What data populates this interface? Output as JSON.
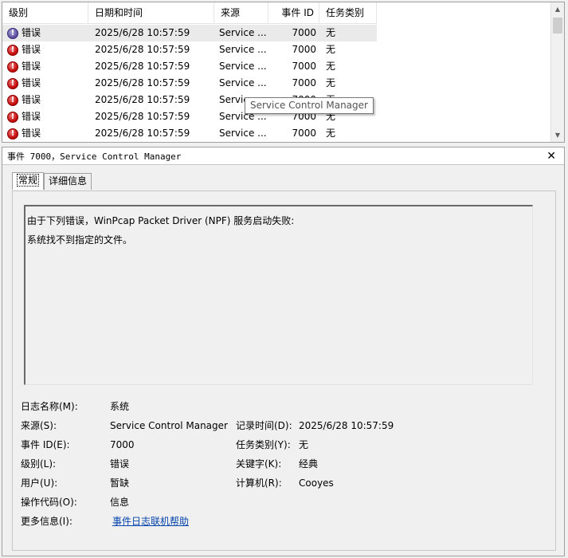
{
  "list": {
    "columns": [
      "级别",
      "日期和时间",
      "来源",
      "事件 ID",
      "任务类别"
    ],
    "rows": [
      {
        "level": "错误",
        "datetime": "2025/6/28 10:57:59",
        "source": "Service ...",
        "event_id": "7000",
        "task": "无"
      },
      {
        "level": "错误",
        "datetime": "2025/6/28 10:57:59",
        "source": "Service ...",
        "event_id": "7000",
        "task": "无"
      },
      {
        "level": "错误",
        "datetime": "2025/6/28 10:57:59",
        "source": "Service ...",
        "event_id": "7000",
        "task": "无"
      },
      {
        "level": "错误",
        "datetime": "2025/6/28 10:57:59",
        "source": "Service ...",
        "event_id": "7000",
        "task": "无"
      },
      {
        "level": "错误",
        "datetime": "2025/6/28 10:57:59",
        "source": "Servic",
        "event_id": "7000",
        "task": "无"
      },
      {
        "level": "错误",
        "datetime": "2025/6/28 10:57:59",
        "source": "Service ...",
        "event_id": "7000",
        "task": "无"
      },
      {
        "level": "错误",
        "datetime": "2025/6/28 10:57:59",
        "source": "Service ...",
        "event_id": "7000",
        "task": "无"
      }
    ],
    "tooltip": "Service Control Manager"
  },
  "detail": {
    "title": "事件 7000，Service Control Manager",
    "tabs": [
      "常规",
      "详细信息"
    ],
    "message_line1": "由于下列错误，WinPcap Packet Driver (NPF) 服务启动失败:",
    "message_line2": "系统找不到指定的文件。",
    "props": {
      "log_name_label": "日志名称(M):",
      "log_name": "系统",
      "source_label": "来源(S):",
      "source": "Service Control Manager",
      "logged_label": "记录时间(D):",
      "logged": "2025/6/28 10:57:59",
      "event_id_label": "事件 ID(E):",
      "event_id": "7000",
      "task_label": "任务类别(Y):",
      "task": "无",
      "level_label": "级别(L):",
      "level": "错误",
      "keywords_label": "关键字(K):",
      "keywords": "经典",
      "user_label": "用户(U):",
      "user": "暂缺",
      "computer_label": "计算机(R):",
      "computer": "Cooyes",
      "opcode_label": "操作代码(O):",
      "opcode": "信息",
      "more_info_label": "更多信息(I):",
      "more_info_link": "事件日志联机帮助"
    }
  },
  "colors": {
    "error_red": "#c00000",
    "link": "#0645ad",
    "selected_row": "#eaeaea"
  }
}
